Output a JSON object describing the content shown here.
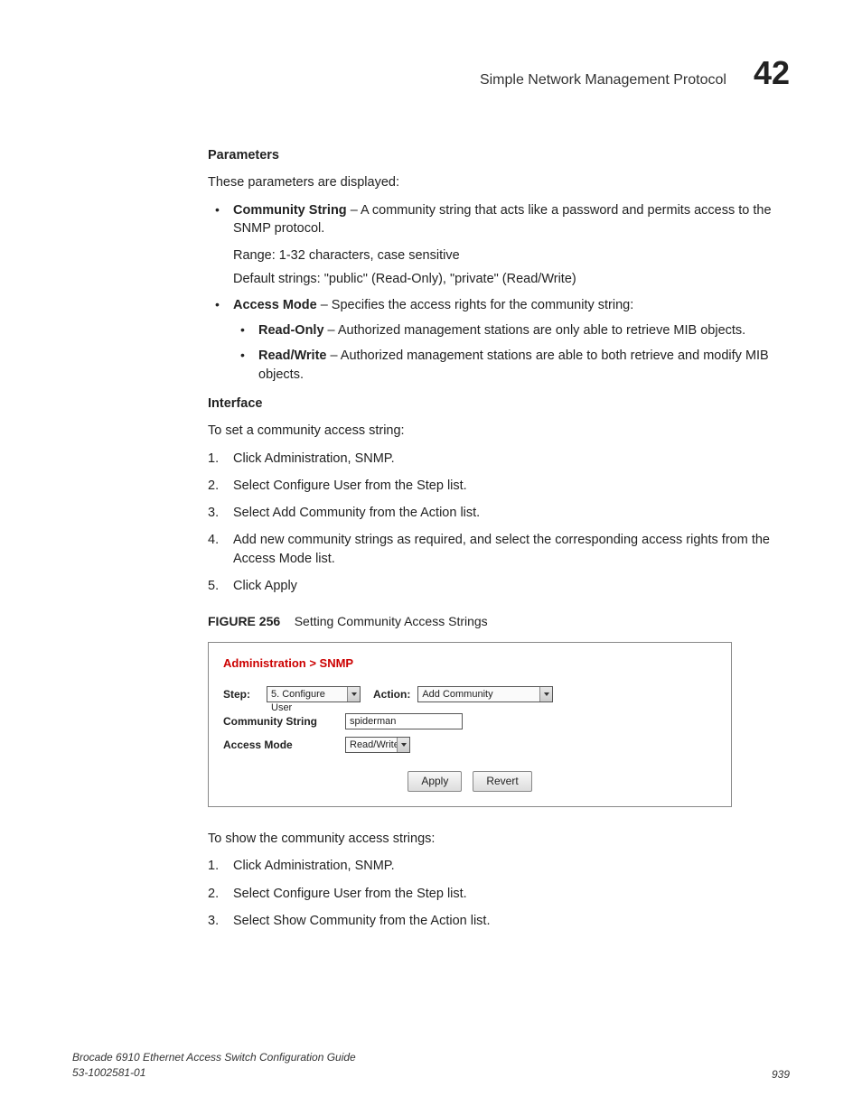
{
  "header": {
    "title": "Simple Network Management Protocol",
    "chapter": "42"
  },
  "sections": {
    "parameters": {
      "heading": "Parameters",
      "intro": "These parameters are displayed:",
      "items": {
        "community_string": {
          "term": "Community String",
          "desc": " – A community string that acts like a password and permits access to the SNMP protocol.",
          "range": "Range: 1-32 characters, case sensitive",
          "defaults": "Default strings: \"public\" (Read-Only), \"private\" (Read/Write)"
        },
        "access_mode": {
          "term": "Access Mode",
          "desc": " – Specifies the access rights for the community string:",
          "sub": {
            "read_only": {
              "term": "Read-Only",
              "desc": " – Authorized management stations are only able to retrieve MIB objects."
            },
            "read_write": {
              "term": "Read/Write",
              "desc": " – Authorized management stations are able to both retrieve and modify MIB objects."
            }
          }
        }
      }
    },
    "interface": {
      "heading": "Interface",
      "intro": "To set a community access string:",
      "steps": [
        "Click Administration, SNMP.",
        "Select Configure User from the Step list.",
        "Select Add Community from the Action list.",
        "Add new community strings as required, and select the corresponding access rights from the Access Mode list.",
        "Click Apply"
      ]
    },
    "figure": {
      "label": "FIGURE 256",
      "caption": "Setting Community Access Strings",
      "breadcrumb": "Administration > SNMP",
      "step_label": "Step:",
      "step_value": "5. Configure User",
      "action_label": "Action:",
      "action_value": "Add Community",
      "community_label": "Community String",
      "community_value": "spiderman",
      "access_label": "Access Mode",
      "access_value": "Read/Write",
      "apply": "Apply",
      "revert": "Revert"
    },
    "show": {
      "intro": "To show the community access strings:",
      "steps": [
        "Click Administration, SNMP.",
        "Select Configure User from the Step list.",
        "Select Show Community from the Action list."
      ]
    }
  },
  "footer": {
    "doc_title": "Brocade 6910 Ethernet Access Switch Configuration Guide",
    "doc_num": "53-1002581-01",
    "page": "939"
  }
}
